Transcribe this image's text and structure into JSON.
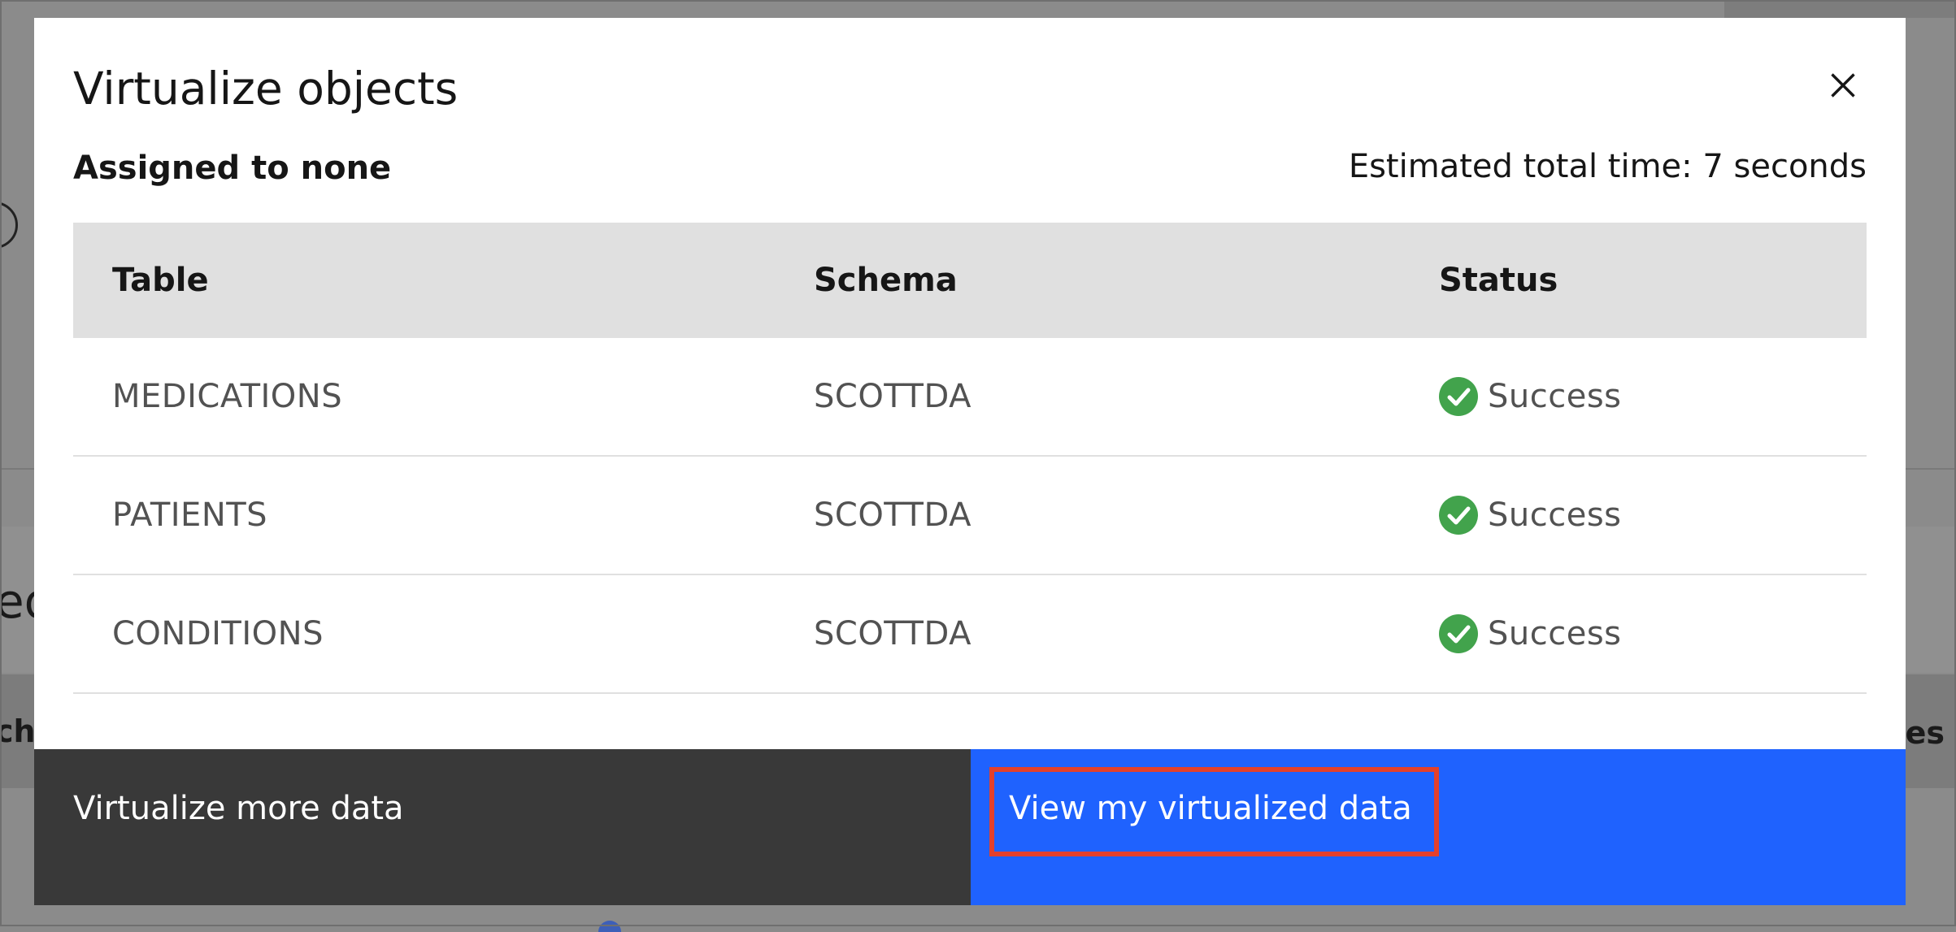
{
  "background": {
    "fragment_heading": "ed",
    "fragment_left_column": "ch",
    "fragment_right_column": "es"
  },
  "modal": {
    "title": "Virtualize objects",
    "assigned": "Assigned to none",
    "estimated_time": "Estimated total time: 7 seconds",
    "close_icon": "close-icon",
    "table": {
      "headers": {
        "table": "Table",
        "schema": "Schema",
        "status": "Status"
      },
      "rows": [
        {
          "table": "MEDICATIONS",
          "schema": "SCOTTDA",
          "status": "Success"
        },
        {
          "table": "PATIENTS",
          "schema": "SCOTTDA",
          "status": "Success"
        },
        {
          "table": "CONDITIONS",
          "schema": "SCOTTDA",
          "status": "Success"
        }
      ],
      "status_icon": "checkmark-filled-icon"
    },
    "footer": {
      "secondary_label": "Virtualize more data",
      "primary_label": "View my virtualized data"
    }
  },
  "colors": {
    "primary_button": "#1f62fe",
    "secondary_button": "#393939",
    "success_green": "#42a34c",
    "highlight_red": "#e4402b",
    "table_header_bg": "#e0e0e0"
  }
}
